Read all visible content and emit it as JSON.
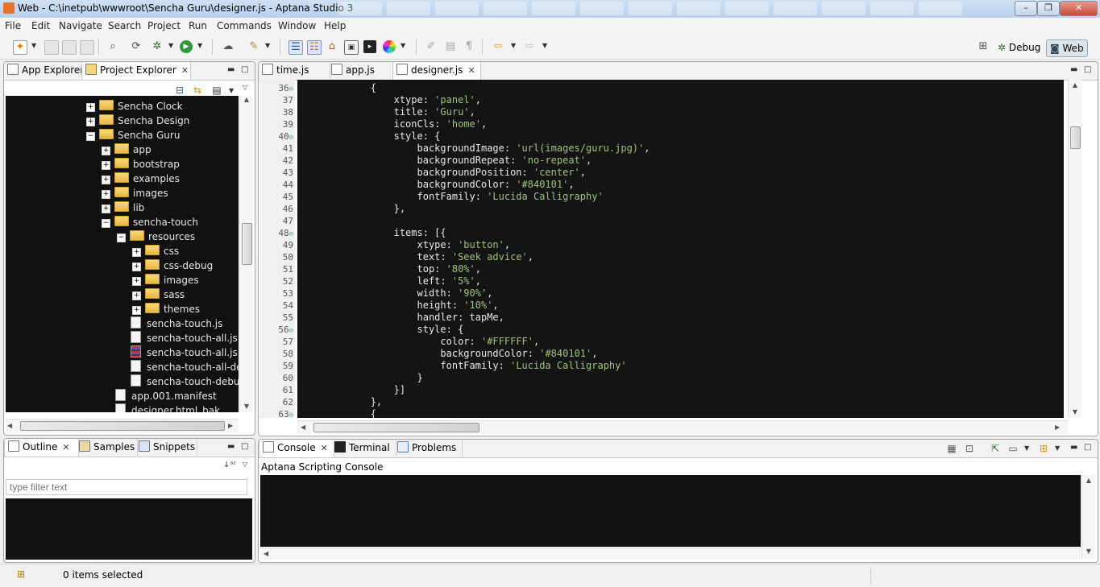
{
  "window": {
    "title": "Web - C:\\inetpub\\wwwroot\\Sencha Guru\\designer.js - Aptana Studio 3",
    "controls": [
      "–",
      "❐",
      "✕"
    ]
  },
  "menu": [
    "File",
    "Edit",
    "Navigate",
    "Search",
    "Project",
    "Run",
    "Commands",
    "Window",
    "Help"
  ],
  "perspectives": {
    "debug": "Debug",
    "web": "Web"
  },
  "left_panel": {
    "tabs": [
      {
        "label": "App Explorer",
        "icon": "app-explorer-icon"
      },
      {
        "label": "Project Explorer",
        "icon": "project-explorer-icon"
      }
    ],
    "tree": [
      {
        "label": "Sencha Clock",
        "depth": 0,
        "type": "folder",
        "expander": "+"
      },
      {
        "label": "Sencha Design",
        "depth": 0,
        "type": "folder",
        "expander": "+"
      },
      {
        "label": "Sencha Guru",
        "depth": 0,
        "type": "folder",
        "expander": "−"
      },
      {
        "label": "app",
        "depth": 1,
        "type": "folder",
        "expander": "+"
      },
      {
        "label": "bootstrap",
        "depth": 1,
        "type": "folder",
        "expander": "+"
      },
      {
        "label": "examples",
        "depth": 1,
        "type": "folder",
        "expander": "+"
      },
      {
        "label": "images",
        "depth": 1,
        "type": "folder",
        "expander": "+"
      },
      {
        "label": "lib",
        "depth": 1,
        "type": "folder",
        "expander": "+"
      },
      {
        "label": "sencha-touch",
        "depth": 1,
        "type": "folder",
        "expander": "−"
      },
      {
        "label": "resources",
        "depth": 2,
        "type": "folder",
        "expander": "−"
      },
      {
        "label": "css",
        "depth": 3,
        "type": "folder",
        "expander": "+"
      },
      {
        "label": "css-debug",
        "depth": 3,
        "type": "folder",
        "expander": "+"
      },
      {
        "label": "images",
        "depth": 3,
        "type": "folder",
        "expander": "+"
      },
      {
        "label": "sass",
        "depth": 3,
        "type": "folder",
        "expander": "+"
      },
      {
        "label": "themes",
        "depth": 3,
        "type": "folder",
        "expander": "+"
      },
      {
        "label": "sencha-touch.js",
        "depth": 2,
        "type": "file"
      },
      {
        "label": "sencha-touch-all.js",
        "depth": 2,
        "type": "file"
      },
      {
        "label": "sencha-touch-all.js.gz",
        "depth": 2,
        "type": "gz"
      },
      {
        "label": "sencha-touch-all-debug.js",
        "depth": 2,
        "type": "file"
      },
      {
        "label": "sencha-touch-debug.js",
        "depth": 2,
        "type": "file"
      },
      {
        "label": "app.001.manifest",
        "depth": 1,
        "type": "file"
      },
      {
        "label": "designer.html_bak",
        "depth": 1,
        "type": "file"
      }
    ]
  },
  "outline_panel": {
    "tabs": [
      {
        "label": "Outline",
        "icon": "outline-icon"
      },
      {
        "label": "Samples",
        "icon": "samples-icon"
      },
      {
        "label": "Snippets",
        "icon": "snippets-icon"
      }
    ],
    "filter_placeholder": "type filter text"
  },
  "editor": {
    "tabs": [
      {
        "label": "time.js",
        "active": false
      },
      {
        "label": "app.js",
        "active": false
      },
      {
        "label": "designer.js",
        "active": true
      }
    ],
    "lines": [
      {
        "n": "36",
        "fold": "⊖",
        "code": [
          [
            "",
            "            {"
          ]
        ]
      },
      {
        "n": "37",
        "fold": "",
        "code": [
          [
            "",
            "                xtype: "
          ],
          [
            "s",
            "'panel'"
          ],
          [
            "",
            ","
          ]
        ]
      },
      {
        "n": "38",
        "fold": "",
        "code": [
          [
            "",
            "                title: "
          ],
          [
            "s",
            "'Guru'"
          ],
          [
            "",
            ","
          ]
        ]
      },
      {
        "n": "39",
        "fold": "",
        "code": [
          [
            "",
            "                iconCls: "
          ],
          [
            "s",
            "'home'"
          ],
          [
            "",
            ","
          ]
        ]
      },
      {
        "n": "40",
        "fold": "⊖",
        "code": [
          [
            "",
            "                style: {"
          ]
        ]
      },
      {
        "n": "41",
        "fold": "",
        "code": [
          [
            "",
            "                    backgroundImage: "
          ],
          [
            "s",
            "'url(images/guru.jpg)'"
          ],
          [
            "",
            ","
          ]
        ]
      },
      {
        "n": "42",
        "fold": "",
        "code": [
          [
            "",
            "                    backgroundRepeat: "
          ],
          [
            "s",
            "'no-repeat'"
          ],
          [
            "",
            ","
          ]
        ]
      },
      {
        "n": "43",
        "fold": "",
        "code": [
          [
            "",
            "                    backgroundPosition: "
          ],
          [
            "s",
            "'center'"
          ],
          [
            "",
            ","
          ]
        ]
      },
      {
        "n": "44",
        "fold": "",
        "code": [
          [
            "",
            "                    backgroundColor: "
          ],
          [
            "s",
            "'#840101'"
          ],
          [
            "",
            ","
          ]
        ]
      },
      {
        "n": "45",
        "fold": "",
        "code": [
          [
            "",
            "                    fontFamily: "
          ],
          [
            "s",
            "'Lucida Calligraphy'"
          ]
        ]
      },
      {
        "n": "46",
        "fold": "",
        "code": [
          [
            "",
            "                },"
          ]
        ]
      },
      {
        "n": "47",
        "fold": "",
        "code": [
          [
            "",
            ""
          ]
        ]
      },
      {
        "n": "48",
        "fold": "⊖",
        "code": [
          [
            "",
            "                items: [{"
          ]
        ]
      },
      {
        "n": "49",
        "fold": "",
        "code": [
          [
            "",
            "                    xtype: "
          ],
          [
            "s",
            "'button'"
          ],
          [
            "",
            ","
          ]
        ]
      },
      {
        "n": "50",
        "fold": "",
        "code": [
          [
            "",
            "                    text: "
          ],
          [
            "s",
            "'Seek advice'"
          ],
          [
            "",
            ","
          ]
        ]
      },
      {
        "n": "51",
        "fold": "",
        "code": [
          [
            "",
            "                    top: "
          ],
          [
            "s",
            "'80%'"
          ],
          [
            "",
            ","
          ]
        ]
      },
      {
        "n": "52",
        "fold": "",
        "code": [
          [
            "",
            "                    left: "
          ],
          [
            "s",
            "'5%'"
          ],
          [
            "",
            ","
          ]
        ]
      },
      {
        "n": "53",
        "fold": "",
        "code": [
          [
            "",
            "                    width: "
          ],
          [
            "s",
            "'90%'"
          ],
          [
            "",
            ","
          ]
        ]
      },
      {
        "n": "54",
        "fold": "",
        "code": [
          [
            "",
            "                    height: "
          ],
          [
            "s",
            "'10%'"
          ],
          [
            "",
            ","
          ]
        ]
      },
      {
        "n": "55",
        "fold": "",
        "code": [
          [
            "",
            "                    handler: tapMe,"
          ]
        ]
      },
      {
        "n": "56",
        "fold": "⊖",
        "code": [
          [
            "",
            "                    style: {"
          ]
        ]
      },
      {
        "n": "57",
        "fold": "",
        "code": [
          [
            "",
            "                        color: "
          ],
          [
            "s",
            "'#FFFFFF'"
          ],
          [
            "",
            ","
          ]
        ]
      },
      {
        "n": "58",
        "fold": "",
        "code": [
          [
            "",
            "                        backgroundColor: "
          ],
          [
            "s",
            "'#840101'"
          ],
          [
            "",
            ","
          ]
        ]
      },
      {
        "n": "59",
        "fold": "",
        "code": [
          [
            "",
            "                        fontFamily: "
          ],
          [
            "s",
            "'Lucida Calligraphy'"
          ]
        ]
      },
      {
        "n": "60",
        "fold": "",
        "code": [
          [
            "",
            "                    }"
          ]
        ]
      },
      {
        "n": "61",
        "fold": "",
        "code": [
          [
            "",
            "                }]"
          ]
        ]
      },
      {
        "n": "62",
        "fold": "",
        "code": [
          [
            "",
            "            },"
          ]
        ]
      },
      {
        "n": "63",
        "fold": "⊖",
        "code": [
          [
            "",
            "            {"
          ]
        ]
      }
    ]
  },
  "console_panel": {
    "tabs": [
      {
        "label": "Console",
        "icon": "console-icon"
      },
      {
        "label": "Terminal",
        "icon": "terminal-icon"
      },
      {
        "label": "Problems",
        "icon": "problems-icon"
      }
    ],
    "title": "Aptana Scripting Console"
  },
  "status": {
    "items_selected": "0 items selected"
  },
  "colors": {
    "editor_bg": "#141414",
    "string": "#9fc27a",
    "title_bar": "#b9d1ee",
    "app_icon": "#e8712b"
  }
}
